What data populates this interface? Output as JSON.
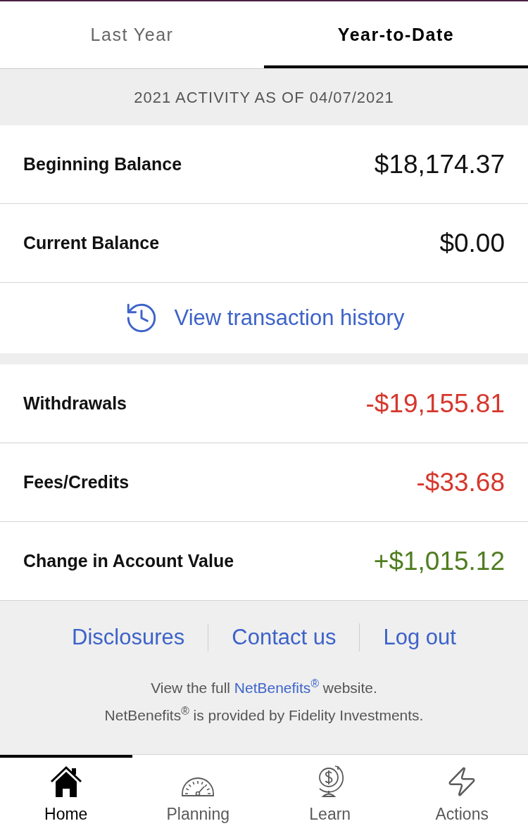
{
  "tabs": [
    {
      "label": "Last Year",
      "selected": false
    },
    {
      "label": "Year-to-Date",
      "selected": true
    }
  ],
  "activity_date": "2021 ACTIVITY AS OF 04/07/2021",
  "balances": [
    {
      "label": "Beginning Balance",
      "amount": "$18,174.37"
    },
    {
      "label": "Current Balance",
      "amount": "$0.00"
    }
  ],
  "history_link": "View transaction history",
  "activity": [
    {
      "label": "Withdrawals",
      "amount": "-$19,155.81",
      "color": "#d6372d"
    },
    {
      "label": "Fees/Credits",
      "amount": "-$33.68",
      "color": "#d6372d"
    },
    {
      "label": "Change in Account Value",
      "amount": "+$1,015.12",
      "color": "#4f7d1f"
    }
  ],
  "footer": {
    "links": [
      "Disclosures",
      "Contact us",
      "Log out"
    ],
    "website_note": {
      "before": "View the full ",
      "link": "NetBenefits$^{®}$",
      "after": " website."
    },
    "provider_note": "NetBenefits$^{®}$ is provided by Fidelity Investments."
  },
  "nav": [
    {
      "label": "Home",
      "selected": true
    },
    {
      "label": "Planning",
      "selected": false
    },
    {
      "label": "Learn",
      "selected": false
    },
    {
      "label": "Actions",
      "selected": false
    }
  ]
}
